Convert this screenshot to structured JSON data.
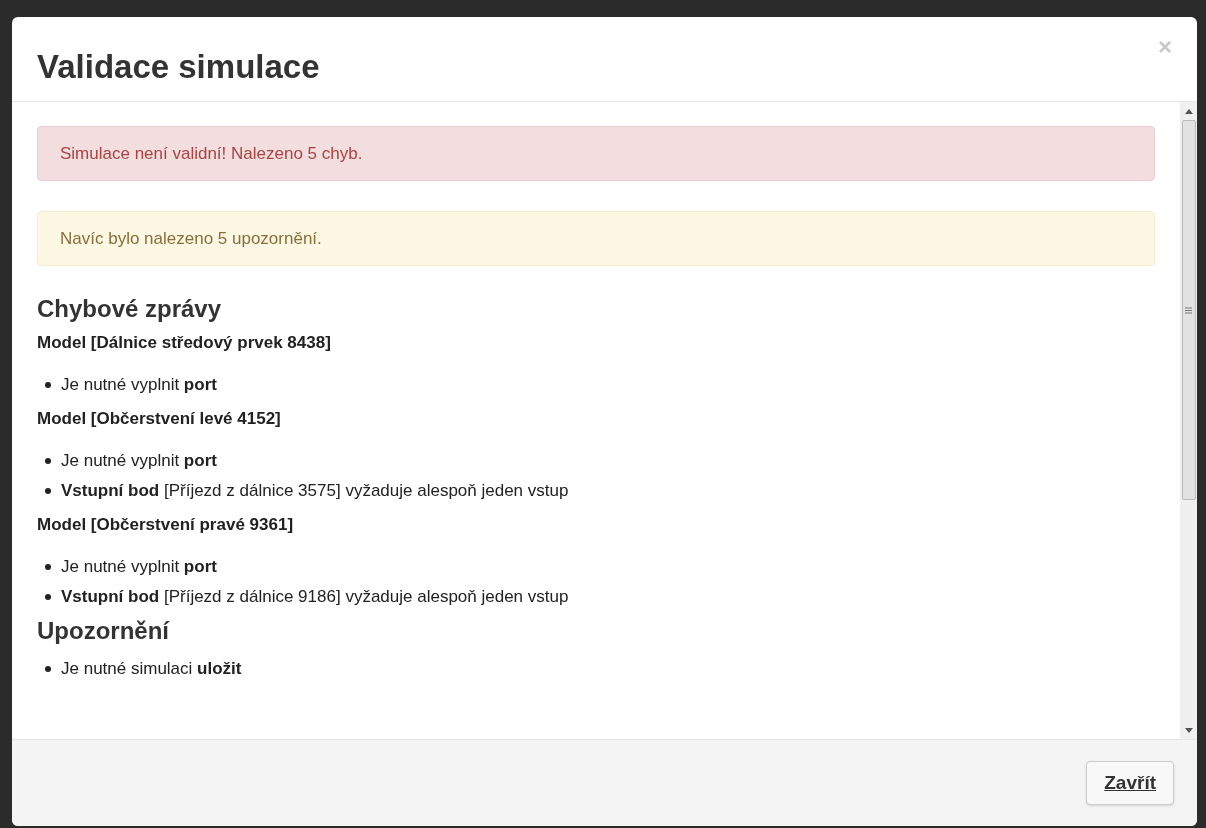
{
  "dialog": {
    "title": "Validace simulace",
    "close": "×"
  },
  "alerts": [
    {
      "kind": "danger",
      "text": "Simulace není validní! Nalezeno 5 chyb."
    },
    {
      "kind": "warning",
      "text": "Navíc bylo nalezeno 5 upozornění."
    }
  ],
  "errors": {
    "heading": "Chybové zprávy",
    "groups": [
      {
        "title": "Model [Dálnice středový prvek 8438]",
        "items": [
          "Je nutné vyplnit **port**"
        ]
      },
      {
        "title": "Model [Občerstvení levé 4152]",
        "items": [
          "Je nutné vyplnit **port**",
          "**Vstupní bod** [Příjezd z dálnice 3575] vyžaduje alespoň jeden vstup"
        ]
      },
      {
        "title": "Model [Občerstvení pravé 9361]",
        "items": [
          "Je nutné vyplnit **port**",
          "**Vstupní bod** [Příjezd z dálnice 9186] vyžaduje alespoň jeden vstup"
        ]
      }
    ]
  },
  "warnings": {
    "heading": "Upozornění",
    "items": [
      "Je nutné simulaci **uložit**"
    ]
  },
  "footer": {
    "button": "Zavřít"
  }
}
